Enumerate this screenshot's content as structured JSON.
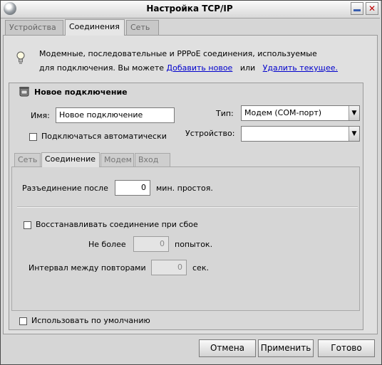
{
  "window": {
    "title": "Настройка TCP/IP"
  },
  "tabs": [
    {
      "label": "Устройства"
    },
    {
      "label": "Соединения"
    },
    {
      "label": "Сеть"
    }
  ],
  "info": {
    "line1": "Модемные, последовательные и PPPoE соединения, используемые",
    "line2_prefix": "для подключения. Вы можете",
    "add_link": "Добавить новое",
    "or": "или",
    "delete_link": "Удалить текущее."
  },
  "connection": {
    "title": "Новое подключение",
    "name_label": "Имя:",
    "name_value": "Новое подключение",
    "type_label": "Тип:",
    "type_value": "Модем (COM-порт)",
    "auto_connect_label": "Подключаться автоматически",
    "device_label": "Устройство:",
    "device_value": ""
  },
  "inner_tabs": [
    {
      "label": "Сеть"
    },
    {
      "label": "Соединение"
    },
    {
      "label": "Модем"
    },
    {
      "label": "Вход"
    }
  ],
  "connection_tab": {
    "disconnect_label": "Разъединение после",
    "disconnect_value": "0",
    "disconnect_suffix": "мин. простоя.",
    "restore_label": "Восстанавливать соединение при сбое",
    "max_label": "Не более",
    "max_value": "0",
    "max_suffix": "попыток.",
    "interval_label": "Интервал между повторами",
    "interval_value": "0",
    "interval_suffix": "сек."
  },
  "use_default_label": "Использовать по умолчанию",
  "buttons": {
    "cancel": "Отмена",
    "apply": "Применить",
    "done": "Готово"
  }
}
